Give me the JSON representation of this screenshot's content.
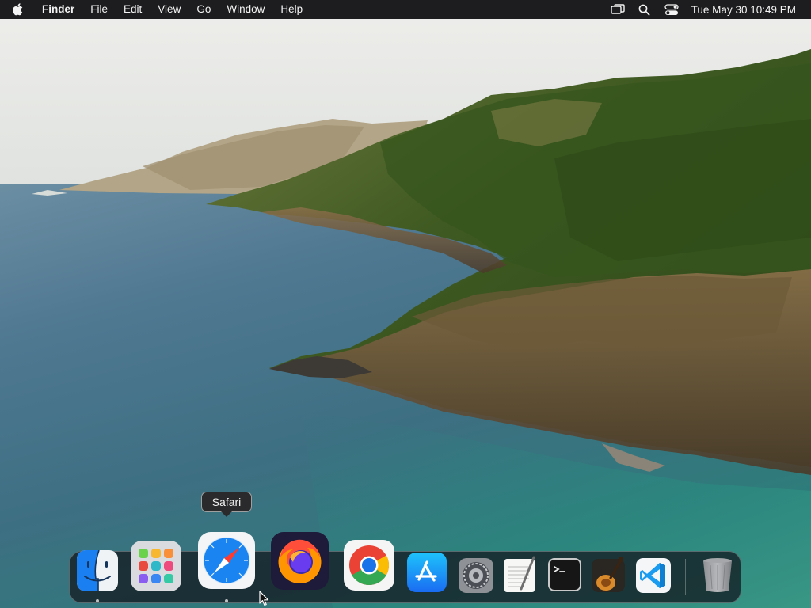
{
  "menubar": {
    "apple_icon": "apple-logo-icon",
    "app_name": "Finder",
    "menus": [
      "File",
      "Edit",
      "View",
      "Go",
      "Window",
      "Help"
    ],
    "status_icons": [
      "screen-mirroring-icon",
      "spotlight-search-icon",
      "control-center-icon"
    ],
    "clock": "Tue May 30  10:49 PM"
  },
  "dock": {
    "tooltip": "Safari",
    "hovered": "Safari",
    "apps": [
      {
        "name": "Finder",
        "icon": "finder-icon",
        "running": true
      },
      {
        "name": "Launchpad",
        "icon": "launchpad-icon",
        "running": false
      },
      {
        "name": "Safari",
        "icon": "safari-icon",
        "running": true
      },
      {
        "name": "Firefox",
        "icon": "firefox-icon",
        "running": false
      },
      {
        "name": "Google Chrome",
        "icon": "chrome-icon",
        "running": false
      },
      {
        "name": "App Store",
        "icon": "app-store-icon",
        "running": false
      },
      {
        "name": "System Settings",
        "icon": "system-settings-icon",
        "running": false
      },
      {
        "name": "TextEdit",
        "icon": "textedit-icon",
        "running": false
      },
      {
        "name": "Terminal",
        "icon": "terminal-icon",
        "running": false
      },
      {
        "name": "GarageBand",
        "icon": "garageband-icon",
        "running": false
      },
      {
        "name": "Visual Studio Code",
        "icon": "vscode-icon",
        "running": false
      }
    ],
    "trash": {
      "name": "Trash",
      "icon": "trash-icon"
    }
  },
  "colors": {
    "menubar_bg": "#1d1d1f",
    "dock_bg": "#141c22",
    "safari_blue": "#1a84f0",
    "firefox_orange": "#ff9500",
    "vscode_blue": "#0f7fd1"
  }
}
